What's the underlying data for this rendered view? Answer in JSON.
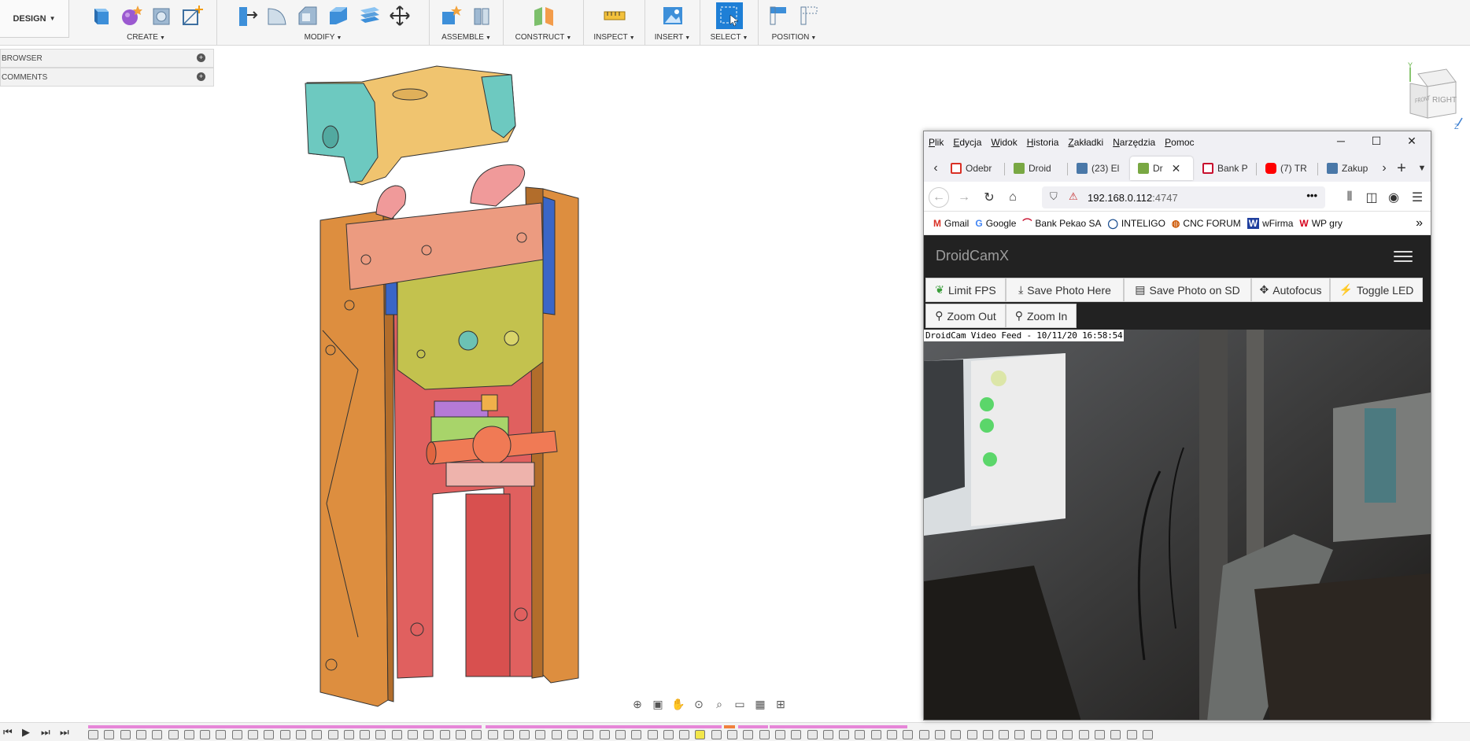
{
  "fusion": {
    "workspace": "DESIGN",
    "groups": [
      {
        "label": "CREATE"
      },
      {
        "label": "MODIFY"
      },
      {
        "label": "ASSEMBLE"
      },
      {
        "label": "CONSTRUCT"
      },
      {
        "label": "INSPECT"
      },
      {
        "label": "INSERT"
      },
      {
        "label": "SELECT"
      },
      {
        "label": "POSITION"
      }
    ],
    "browser_label": "BROWSER",
    "comments_label": "COMMENTS",
    "viewcube": {
      "front": "FRONT",
      "right": "RIGHT",
      "axis_x": "X",
      "axis_y": "Y",
      "axis_z": "Z"
    }
  },
  "firefox": {
    "menu": [
      {
        "label": "Plik",
        "accel": "P",
        "rest": "lik"
      },
      {
        "label": "Edycja",
        "accel": "E",
        "rest": "dycja"
      },
      {
        "label": "Widok",
        "accel": "W",
        "rest": "idok"
      },
      {
        "label": "Historia",
        "accel": "H",
        "rest": "istoria"
      },
      {
        "label": "Zakładki",
        "accel": "Z",
        "rest": "akładki"
      },
      {
        "label": "Narzędzia",
        "accel": "N",
        "rest": "arzędzia"
      },
      {
        "label": "Pomoc",
        "accel": "P",
        "rest": "omoc"
      }
    ],
    "tabs": [
      {
        "title": "Odebr",
        "favicon_color": "#d93025"
      },
      {
        "title": "Droid",
        "favicon_color": "#79a843"
      },
      {
        "title": "(23) El",
        "favicon_color": "#4a78a8"
      },
      {
        "title": "Dr",
        "favicon_color": "#79a843"
      },
      {
        "title": "Bank P",
        "favicon_color": "#c8102e"
      },
      {
        "title": "(7) TR",
        "favicon_color": "#ff0000"
      },
      {
        "title": "Zakup",
        "favicon_color": "#4a78a8"
      }
    ],
    "url_host": "192.168.0.112",
    "url_port": ":4747",
    "bookmarks": [
      {
        "label": "Gmail",
        "icon": "M",
        "color": "#d93025"
      },
      {
        "label": "Google",
        "icon": "G",
        "color": "#4285f4"
      },
      {
        "label": "Bank Pekao SA",
        "icon": "⌒",
        "color": "#c8102e"
      },
      {
        "label": "INTELIGO",
        "icon": "◯",
        "color": "#1a4d8f"
      },
      {
        "label": "CNC FORUM",
        "icon": "◍",
        "color": "#cc5500"
      },
      {
        "label": "wFirma",
        "icon": "W",
        "color": "#1f3f9e"
      },
      {
        "label": "WP gry",
        "icon": "W",
        "color": "#d6001c"
      }
    ],
    "page": {
      "brand": "DroidCamX",
      "buttons_row1": [
        "Limit FPS",
        "Save Photo Here",
        "Save Photo on SD",
        "Autofocus",
        "Toggle LED"
      ],
      "buttons_row2": [
        "Zoom Out",
        "Zoom In"
      ],
      "feed_stamp": "DroidCam Video Feed - 10/11/20 16:58:54"
    }
  }
}
